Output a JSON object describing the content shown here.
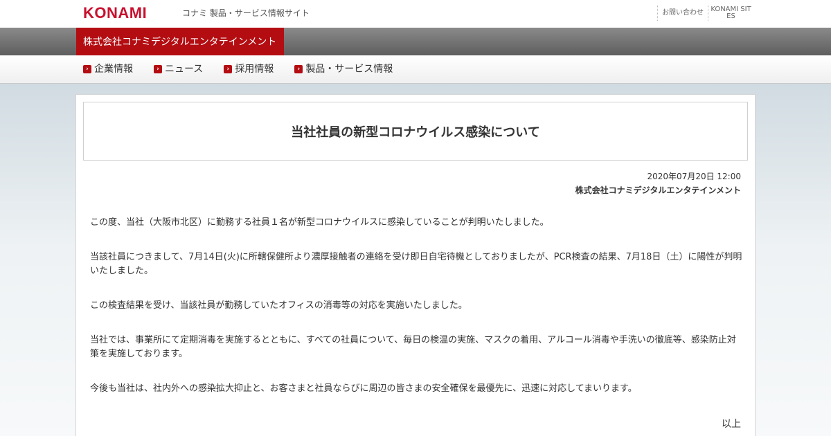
{
  "header": {
    "logo_text": "KONAMI",
    "site_label": "コナミ 製品・サービス情報サイト",
    "links": [
      "お問い合わせ",
      "KONAMI SITES"
    ],
    "brand_color": "#c8102e"
  },
  "company_bar": {
    "name": "株式会社コナミデジタルエンタテインメント",
    "accent_color": "#b30d12"
  },
  "nav": {
    "items": [
      {
        "label": "企業情報",
        "icon": "chevron-right-icon"
      },
      {
        "label": "ニュース",
        "icon": "chevron-right-icon"
      },
      {
        "label": "採用情報",
        "icon": "chevron-right-icon"
      },
      {
        "label": "製品・サービス情報",
        "icon": "chevron-right-icon"
      }
    ]
  },
  "article": {
    "title": "当社社員の新型コロナウイルス感染について",
    "date": "2020年07月20日 12:00",
    "author": "株式会社コナミデジタルエンタテインメント",
    "paragraphs": [
      "この度、当社（大阪市北区）に勤務する社員１名が新型コロナウイルスに感染していることが判明いたしました。",
      "当該社員につきまして、7月14日(火)に所轄保健所より濃厚接触者の連絡を受け即日自宅待機としておりましたが、PCR検査の結果、7月18日（土）に陽性が判明いたしました。",
      "この検査結果を受け、当該社員が勤務していたオフィスの消毒等の対応を実施いたしました。",
      "当社では、事業所にて定期消毒を実施するとともに、すべての社員について、毎日の検温の実施、マスクの着用、アルコール消毒や手洗いの徹底等、感染防止対策を実施しております。",
      "今後も当社は、社内外への感染拡大抑止と、お客さまと社員ならびに周辺の皆さまの安全確保を最優先に、迅速に対応してまいります。"
    ],
    "closing": "以上"
  }
}
